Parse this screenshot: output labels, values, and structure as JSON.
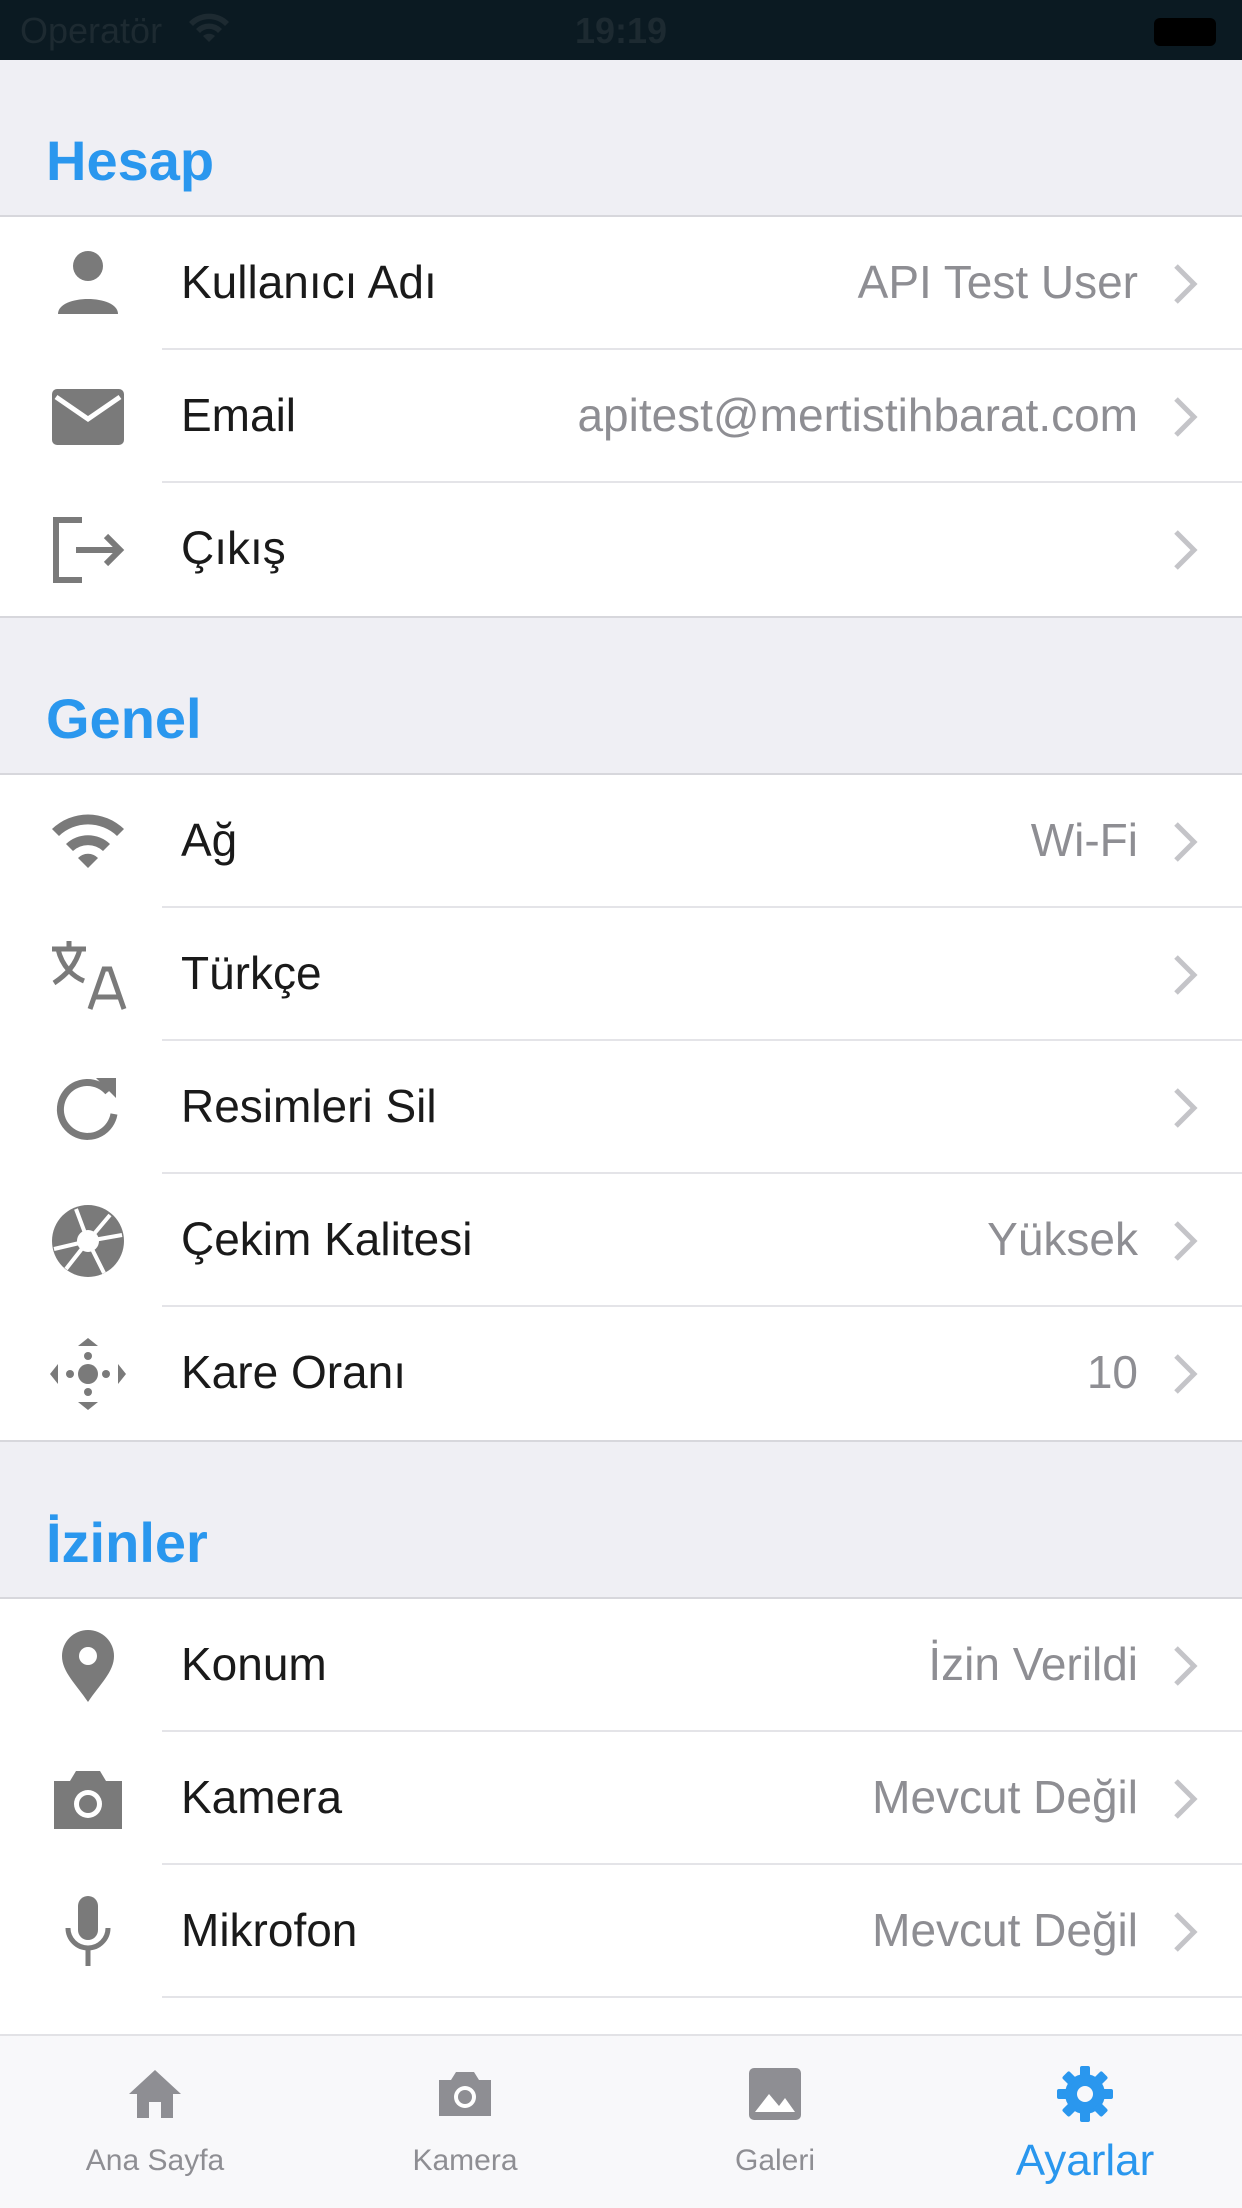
{
  "status_bar": {
    "carrier": "Operatör",
    "time": "19:19"
  },
  "sections": [
    {
      "title": "Hesap",
      "rows": [
        {
          "icon": "person-icon",
          "label": "Kullanıcı Adı",
          "value": "API Test User"
        },
        {
          "icon": "mail-icon",
          "label": "Email",
          "value": "apitest@mertistihbarat.com"
        },
        {
          "icon": "logout-icon",
          "label": "Çıkış",
          "value": ""
        }
      ]
    },
    {
      "title": "Genel",
      "rows": [
        {
          "icon": "wifi-icon",
          "label": "Ağ",
          "value": "Wi-Fi"
        },
        {
          "icon": "translate-icon",
          "label": "Türkçe",
          "value": ""
        },
        {
          "icon": "refresh-icon",
          "label": "Resimleri Sil",
          "value": ""
        },
        {
          "icon": "shutter-icon",
          "label": "Çekim Kalitesi",
          "value": "Yüksek"
        },
        {
          "icon": "frame-rate-icon",
          "label": "Kare Oranı",
          "value": "10"
        }
      ]
    },
    {
      "title": "İzinler",
      "rows": [
        {
          "icon": "location-pin-icon",
          "label": "Konum",
          "value": "İzin Verildi"
        },
        {
          "icon": "camera-icon",
          "label": "Kamera",
          "value": "Mevcut Değil"
        },
        {
          "icon": "microphone-icon",
          "label": "Mikrofon",
          "value": "Mevcut Değil"
        }
      ]
    }
  ],
  "tabs": [
    {
      "icon": "home-icon",
      "label": "Ana Sayfa",
      "active": false
    },
    {
      "icon": "camera-icon",
      "label": "Kamera",
      "active": false
    },
    {
      "icon": "gallery-icon",
      "label": "Galeri",
      "active": false
    },
    {
      "icon": "gear-icon",
      "label": "Ayarlar",
      "active": true
    }
  ],
  "colors": {
    "accent": "#2a97ee",
    "icon_gray": "#7a7a7a",
    "value_gray": "#8e8e93",
    "background": "#efeff4"
  }
}
